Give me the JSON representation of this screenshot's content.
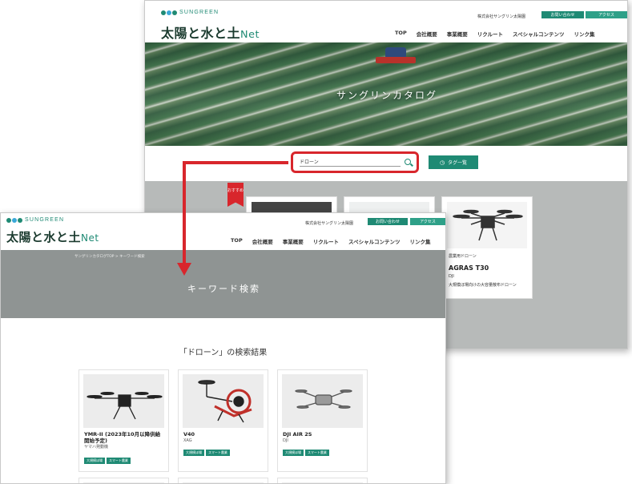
{
  "site": {
    "brand": "SUNGREEN",
    "title": "太陽と水と土",
    "title_suffix": "Net",
    "company": "株式会社サングリン太陽園",
    "contact_button": "お問い合わせ",
    "access_button": "アクセス",
    "nav": [
      "TOP",
      "会社概要",
      "事業概要",
      "リクルート",
      "スペシャルコンテンツ",
      "リンク集"
    ]
  },
  "catalog_page": {
    "hero_title": "サングリンカタログ",
    "search_value": "ドローン",
    "tag_button": "タグ一覧",
    "recommend_badge": "おすすめ",
    "featured": {
      "category": "農業用ドローン",
      "name": "AGRAS T30",
      "maker": "DJI",
      "desc": "大規模ほ場向けの大容量散布ドローン"
    }
  },
  "results_page": {
    "breadcrumb": "サングリンカタログTOP > キーワード検索",
    "band_title": "キーワード検索",
    "results_title": "「ドローン」の検索結果",
    "cards": [
      {
        "name": "YMR-II (2023年10月以降供給開始予定)",
        "maker": "ヤマハ発動機",
        "tags": [
          "大規模ほ場",
          "スマート農業"
        ]
      },
      {
        "name": "V40",
        "maker": "XAG",
        "tags": [
          "大規模ほ場",
          "スマート農業"
        ]
      },
      {
        "name": "DJI AIR 2S",
        "maker": "DJI",
        "tags": [
          "大規模ほ場",
          "スマート農業"
        ]
      }
    ]
  },
  "colors": {
    "accent": "#1f8a74",
    "highlight": "#d8262c",
    "band": "#8f9493"
  },
  "icons": [
    "search-icon",
    "tag-icon",
    "drone-icon",
    "arrow-connector"
  ]
}
